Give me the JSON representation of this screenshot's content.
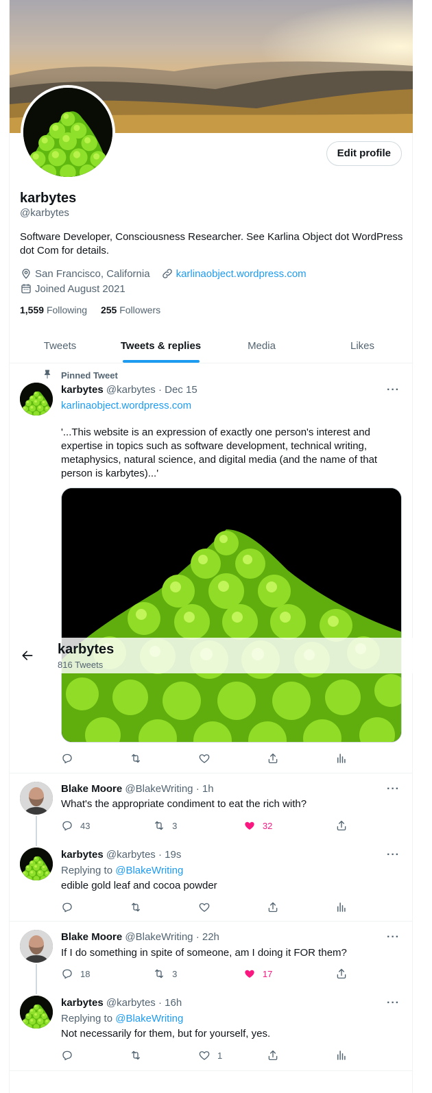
{
  "profile": {
    "display_name": "karbytes",
    "handle": "@karbytes",
    "bio": "Software Developer, Consciousness Researcher. See Karlina Object dot WordPress dot Com for details.",
    "location": "San Francisco, California",
    "website": "karlinaobject.wordpress.com",
    "joined": "Joined August 2021",
    "following_count": "1,559",
    "following_label": "Following",
    "followers_count": "255",
    "followers_label": "Followers",
    "edit_label": "Edit profile"
  },
  "sticky_header": {
    "name": "karbytes",
    "tweet_count": "816 Tweets"
  },
  "tabs": [
    {
      "label": "Tweets",
      "active": false
    },
    {
      "label": "Tweets & replies",
      "active": true
    },
    {
      "label": "Media",
      "active": false
    },
    {
      "label": "Likes",
      "active": false
    }
  ],
  "pinned": {
    "pin_label": "Pinned Tweet",
    "name": "karbytes",
    "meta": "@karbytes · Dec 15",
    "link": "karlinaobject.wordpress.com",
    "text": "'...This website is an expression of exactly one person's interest and expertise in topics such as software development, technical writing, metaphysics, natural science, and digital media (and the name of that person is karbytes)...'"
  },
  "tweets": [
    {
      "name": "Blake Moore",
      "meta": "@BlakeWriting · 1h",
      "text": "What's the appropriate condiment to eat the rich with?",
      "replies": "43",
      "retweets": "3",
      "likes": "32"
    },
    {
      "name": "karbytes",
      "meta": "@karbytes · 19s",
      "replying_prefix": "Replying to ",
      "replying_to": "@BlakeWriting",
      "text": "edible gold leaf and cocoa powder"
    },
    {
      "name": "Blake Moore",
      "meta": "@BlakeWriting · 22h",
      "text": "If I do something in spite of someone, am I doing it FOR them?",
      "replies": "18",
      "retweets": "3",
      "likes": "17"
    },
    {
      "name": "karbytes",
      "meta": "@karbytes · 16h",
      "replying_prefix": "Replying to ",
      "replying_to": "@BlakeWriting",
      "text": "Not necessarily for them, but for yourself, yes.",
      "likes": "1"
    }
  ],
  "more_glyph": "···",
  "colors": {
    "accent": "#1d9bf0",
    "like": "#f91880",
    "muted": "#536471"
  }
}
